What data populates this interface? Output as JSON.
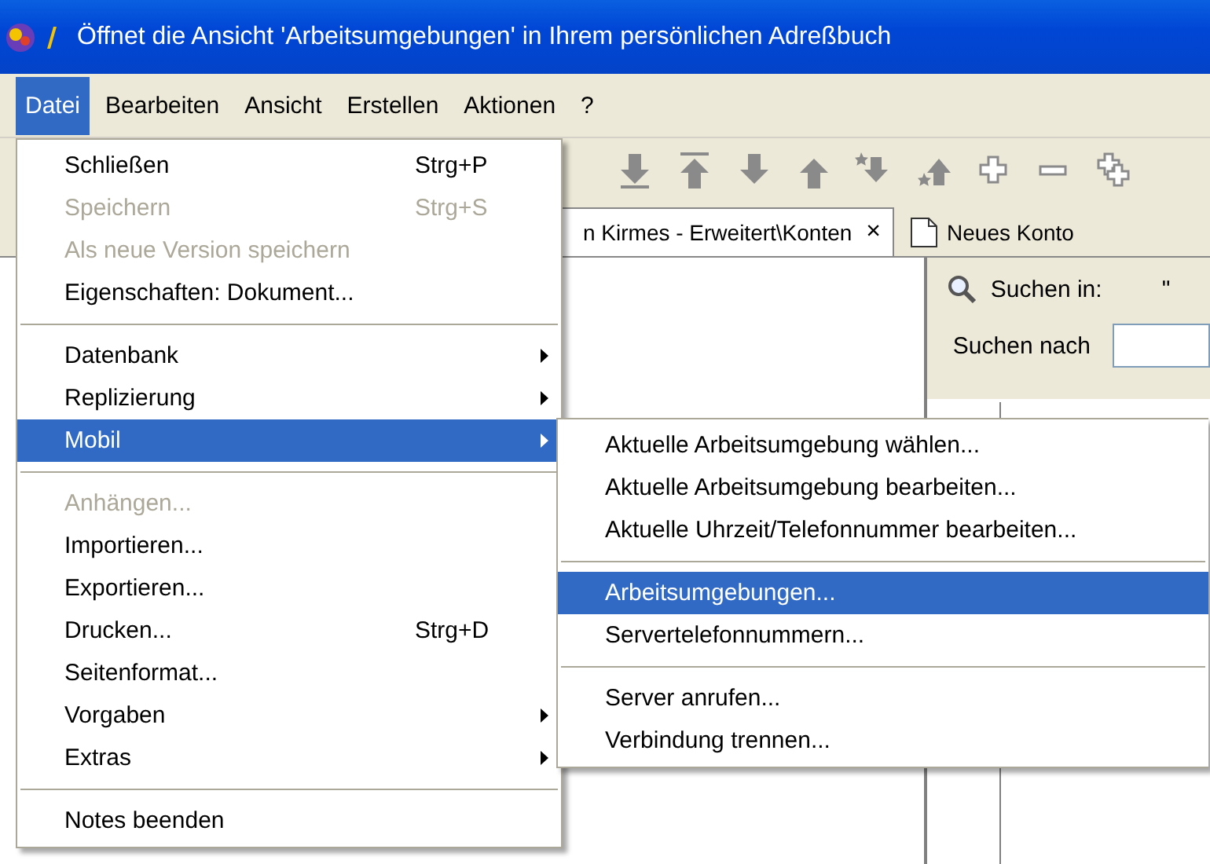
{
  "window": {
    "title": "Öffnet die Ansicht 'Arbeitsumgebungen' in Ihrem persönlichen Adreßbuch"
  },
  "menubar": [
    {
      "label": "Datei",
      "selected": true
    },
    {
      "label": "Bearbeiten",
      "selected": false
    },
    {
      "label": "Ansicht",
      "selected": false
    },
    {
      "label": "Erstellen",
      "selected": false
    },
    {
      "label": "Aktionen",
      "selected": false
    },
    {
      "label": "?",
      "selected": false
    }
  ],
  "tabs": [
    {
      "label": "n Kirmes - Erweitert\\Konten",
      "close": "×"
    }
  ],
  "new_tab": {
    "label": "Neues Konto"
  },
  "search": {
    "scope_label": "Suchen in:",
    "scope_value": "\"",
    "query_label": "Suchen nach"
  },
  "file_menu": {
    "items": [
      {
        "kind": "item",
        "label": "Schließen",
        "shortcut": "Strg+P",
        "disabled": false,
        "selected": false,
        "submenu": false
      },
      {
        "kind": "item",
        "label": "Speichern",
        "shortcut": "Strg+S",
        "disabled": true,
        "selected": false,
        "submenu": false
      },
      {
        "kind": "item",
        "label": "Als neue Version speichern",
        "disabled": true,
        "selected": false,
        "submenu": false
      },
      {
        "kind": "item",
        "label": "Eigenschaften: Dokument...",
        "disabled": false,
        "selected": false,
        "submenu": false
      },
      {
        "kind": "separator"
      },
      {
        "kind": "item",
        "label": "Datenbank",
        "disabled": false,
        "selected": false,
        "submenu": true
      },
      {
        "kind": "item",
        "label": "Replizierung",
        "disabled": false,
        "selected": false,
        "submenu": true
      },
      {
        "kind": "item",
        "label": "Mobil",
        "disabled": false,
        "selected": true,
        "submenu": true
      },
      {
        "kind": "separator"
      },
      {
        "kind": "item",
        "label": "Anhängen...",
        "disabled": true,
        "selected": false,
        "submenu": false
      },
      {
        "kind": "item",
        "label": "Importieren...",
        "disabled": false,
        "selected": false,
        "submenu": false
      },
      {
        "kind": "item",
        "label": "Exportieren...",
        "disabled": false,
        "selected": false,
        "submenu": false
      },
      {
        "kind": "item",
        "label": "Drucken...",
        "shortcut": "Strg+D",
        "disabled": false,
        "selected": false,
        "submenu": false
      },
      {
        "kind": "item",
        "label": "Seitenformat...",
        "disabled": false,
        "selected": false,
        "submenu": false
      },
      {
        "kind": "item",
        "label": "Vorgaben",
        "disabled": false,
        "selected": false,
        "submenu": true
      },
      {
        "kind": "item",
        "label": "Extras",
        "disabled": false,
        "selected": false,
        "submenu": true
      },
      {
        "kind": "separator"
      },
      {
        "kind": "item",
        "label": "Notes beenden",
        "disabled": false,
        "selected": false,
        "submenu": false
      }
    ]
  },
  "submenu": {
    "items": [
      {
        "kind": "item",
        "label": "Aktuelle Arbeitsumgebung wählen...",
        "disabled": false,
        "selected": false
      },
      {
        "kind": "item",
        "label": "Aktuelle Arbeitsumgebung bearbeiten...",
        "disabled": false,
        "selected": false
      },
      {
        "kind": "item",
        "label": "Aktuelle Uhrzeit/Telefonnummer bearbeiten...",
        "disabled": false,
        "selected": false
      },
      {
        "kind": "separator"
      },
      {
        "kind": "item",
        "label": "Arbeitsumgebungen...",
        "disabled": false,
        "selected": true
      },
      {
        "kind": "item",
        "label": "Servertelefonnummern...",
        "disabled": false,
        "selected": false
      },
      {
        "kind": "separator"
      },
      {
        "kind": "item",
        "label": "Server anrufen...",
        "disabled": false,
        "selected": false
      },
      {
        "kind": "item",
        "label": "Verbindung trennen...",
        "disabled": false,
        "selected": false
      }
    ]
  }
}
